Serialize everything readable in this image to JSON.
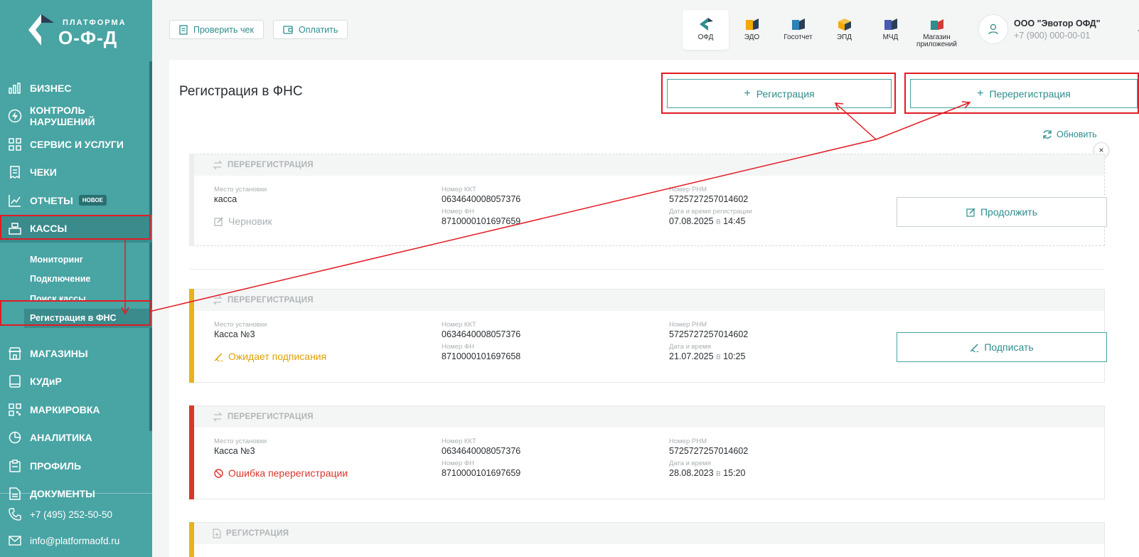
{
  "brand": {
    "top": "ПЛАТФОРМА",
    "main": "О-Ф-Д"
  },
  "sidebar": {
    "items": [
      {
        "label": "БИЗНЕС",
        "icon": "bar-chart-icon"
      },
      {
        "label": "КОНТРОЛЬ НАРУШЕНИЙ",
        "icon": "lightning-icon"
      },
      {
        "label": "СЕРВИС И УСЛУГИ",
        "icon": "grid-icon"
      },
      {
        "label": "ЧЕКИ",
        "icon": "receipt-icon"
      },
      {
        "label": "ОТЧЕТЫ",
        "icon": "report-chart-icon",
        "badge": "НОВОЕ"
      },
      {
        "label": "КАССЫ",
        "icon": "cash-register-icon"
      }
    ],
    "subitems": [
      "Мониторинг",
      "Подключение",
      "Поиск кассы",
      "Регистрация в ФНС"
    ],
    "items2": [
      {
        "label": "МАГАЗИНЫ",
        "icon": "store-icon"
      },
      {
        "label": "КУДиР",
        "icon": "book-icon"
      },
      {
        "label": "МАРКИРОВКА",
        "icon": "qr-icon"
      },
      {
        "label": "АНАЛИТИКА",
        "icon": "pie-chart-icon"
      },
      {
        "label": "ПРОФИЛЬ",
        "icon": "clipboard-icon"
      },
      {
        "label": "ДОКУМЕНТЫ",
        "icon": "document-icon"
      }
    ],
    "phone": "+7 (495) 252-50-50",
    "email": "info@platformaofd.ru"
  },
  "topbar": {
    "check_label": "Проверить чек",
    "pay_label": "Оплатить",
    "apps": [
      {
        "label": "ОФД",
        "color": "#2f8d8d"
      },
      {
        "label": "ЭДО",
        "color": "#f2a900"
      },
      {
        "label": "Госотчет",
        "color": "#2d82b7"
      },
      {
        "label": "ЭПД",
        "color": "#f2a900"
      },
      {
        "label": "МЧД",
        "color": "#4a5ab0"
      },
      {
        "label": "Магазин приложений",
        "color": "#d43b3b"
      }
    ],
    "org": "ООО \"Эвотор ОФД\"",
    "phone": "+7 (900) 000-00-01"
  },
  "main": {
    "title": "Регистрация в ФНС",
    "register_label": "Регистрация",
    "reregister_label": "Перерегистрация",
    "refresh_label": "Обновить",
    "close_label": "×"
  },
  "cards": [
    {
      "type": "ПЕРЕРЕГИСТРАЦИЯ",
      "place_label": "Место установки",
      "place": "касса",
      "kkt_label": "Номер ККТ",
      "kkt": "0634640008057376",
      "fn_label": "Номер ФН",
      "fn": "8710000101697659",
      "rnm_label": "Номер РНМ",
      "rnm": "5725727257014602",
      "date_label": "Дата и время регистрации",
      "date": "07.08.2025",
      "in": "в",
      "time": "14:45",
      "status": "Черновик",
      "status_color": "#a9b0b3",
      "action": "Продолжить"
    },
    {
      "type": "ПЕРЕРЕГИСТРАЦИЯ",
      "place_label": "Место установки",
      "place": "Касса №3",
      "kkt_label": "Номер ККТ",
      "kkt": "0634640008057376",
      "fn_label": "Номер ФН",
      "fn": "8710000101697658",
      "rnm_label": "Номер РНМ",
      "rnm": "5725727257014602",
      "date_label": "Дата и время",
      "date": "21.07.2025",
      "in": "в",
      "time": "10:25",
      "status": "Ожидает подписания",
      "status_color": "#e0a100",
      "action": "Подписать",
      "accent": "#e8b21a"
    },
    {
      "type": "ПЕРЕРЕГИСТРАЦИЯ",
      "place_label": "Место установки",
      "place": "Касса №3",
      "kkt_label": "Номер ККТ",
      "kkt": "0634640008057376",
      "fn_label": "Номер ФН",
      "fn": "8710000101697659",
      "rnm_label": "Номер РНМ",
      "rnm": "5725727257014602",
      "date_label": "Дата и время",
      "date": "28.08.2023",
      "in": "в",
      "time": "15:20",
      "status": "Ошибка перерегистрации",
      "status_color": "#d9362c",
      "accent": "#d9362c"
    },
    {
      "type": "РЕГИСТРАЦИЯ",
      "accent": "#e8b21a"
    }
  ],
  "annotation_color": "#e21b23"
}
